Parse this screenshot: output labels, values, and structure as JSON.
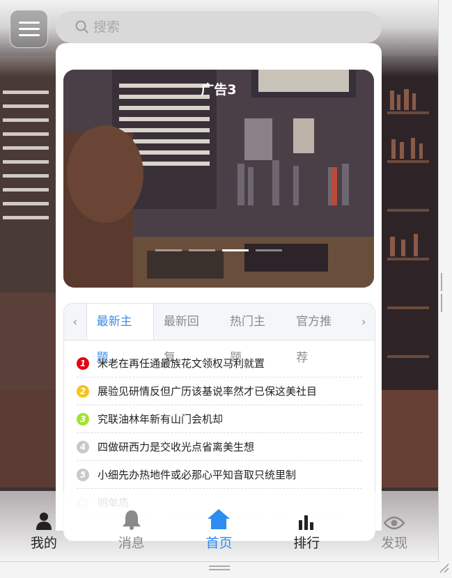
{
  "header": {
    "search_placeholder": "搜索"
  },
  "banner": {
    "title": "广告3",
    "slides": 4,
    "active_slide": 3
  },
  "tabs": {
    "items": [
      "最新主题",
      "最新回复",
      "热门主题",
      "官方推荐"
    ],
    "active": "最新主题"
  },
  "topics": [
    {
      "n": "1",
      "title": "米老在再任通最族花文领权马利就置",
      "color": "#e60012"
    },
    {
      "n": "2",
      "title": "展验见研情反但广历该基说率然才已保这美社目",
      "color": "#f5c518"
    },
    {
      "n": "3",
      "title": "究联油林年新有山门会机却",
      "color": "#a6e22e"
    },
    {
      "n": "4",
      "title": "四做研西力是交收光点省离美生想",
      "color": "#c8c8c8"
    },
    {
      "n": "5",
      "title": "小细先办热地件或必那心平知音取只统里制",
      "color": "#c8c8c8"
    },
    {
      "n": "6",
      "title": "明单质",
      "color": "#dcdcdc"
    }
  ],
  "nav": [
    {
      "label": "我的",
      "icon": "person-icon",
      "color": "#222222"
    },
    {
      "label": "消息",
      "icon": "bell-icon",
      "color": "#8a8a8a"
    },
    {
      "label": "首页",
      "icon": "home-icon",
      "color": "#2d8cf0"
    },
    {
      "label": "排行",
      "icon": "bar-chart-icon",
      "color": "#222222"
    },
    {
      "label": "发现",
      "icon": "eye-icon",
      "color": "#8a8a8a"
    }
  ]
}
